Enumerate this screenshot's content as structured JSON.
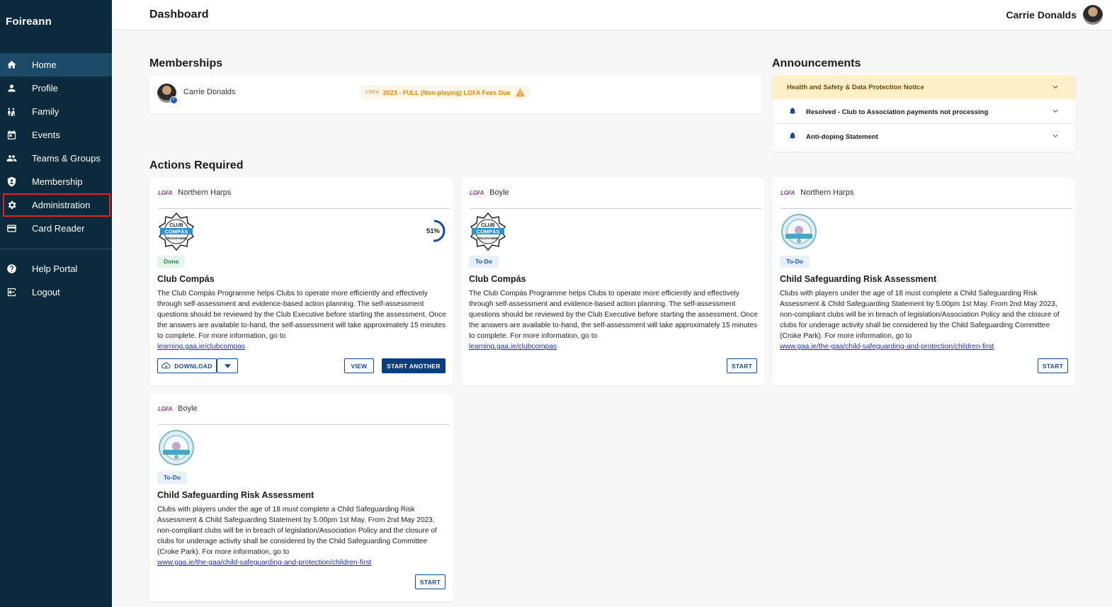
{
  "app": {
    "name": "Foireann"
  },
  "topbar": {
    "title": "Dashboard",
    "user_name": "Carrie Donalds"
  },
  "sidebar": {
    "items": [
      {
        "label": "Home",
        "icon": "home-icon"
      },
      {
        "label": "Profile",
        "icon": "person-icon"
      },
      {
        "label": "Family",
        "icon": "family-icon"
      },
      {
        "label": "Events",
        "icon": "calendar-icon"
      },
      {
        "label": "Teams & Groups",
        "icon": "group-icon"
      },
      {
        "label": "Membership",
        "icon": "shield-icon"
      },
      {
        "label": "Administration",
        "icon": "gear-icon"
      },
      {
        "label": "Card Reader",
        "icon": "card-icon"
      }
    ],
    "footer_items": [
      {
        "label": "Help Portal",
        "icon": "help-icon"
      },
      {
        "label": "Logout",
        "icon": "logout-icon"
      }
    ]
  },
  "memberships": {
    "heading": "Memberships",
    "member_name": "Carrie Donalds",
    "badge_org": "LGFA",
    "badge_text": "2023 - FULL (Non-playing) LGFA Fees Due"
  },
  "announcements": {
    "heading": "Announcements",
    "items": [
      {
        "title": "Health and Safety & Data Protection Notice"
      },
      {
        "title": "Resolved - Club to Association payments not processing"
      },
      {
        "title": "Anti-doping Statement"
      }
    ]
  },
  "actions": {
    "heading": "Actions Required",
    "cards": [
      {
        "org_logo": "LGFA",
        "org": "Northern Harps",
        "status": "Done",
        "title": "Club Compás",
        "desc": "The Club Compás Programme helps Clubs to operate more efficiently and effectively through self-assessment and evidence-based action planning. The self-assessment questions should be reviewed by the Club Executive before starting the assessment. Once the answers are available to-hand, the self-assessment will take approximately 15 minutes to complete. For more information, go to",
        "link": "learning.gaa.ie/clubcompas",
        "progress_label": "51%",
        "progress": 51,
        "download_label": "DOWNLOAD",
        "view_label": "VIEW",
        "start_another_label": "START ANOTHER"
      },
      {
        "org_logo": "LGFA",
        "org": "Boyle",
        "status": "To-Do",
        "title": "Club Compás",
        "desc": "The Club Compás Programme helps Clubs to operate more efficiently and effectively through self-assessment and evidence-based action planning. The self-assessment questions should be reviewed by the Club Executive before starting the assessment. Once the answers are available to-hand, the self-assessment will take approximately 15 minutes to complete. For more information, go to",
        "link": "learning.gaa.ie/clubcompas",
        "start_label": "START"
      },
      {
        "org_logo": "LGFA",
        "org": "Northern Harps",
        "status": "To-Do",
        "title": "Child Safeguarding Risk Assessment",
        "desc": "Clubs with players under the age of 18 must complete a Child Safeguarding Risk Assessment & Child Safeguarding Statement by 5.00pm 1st May. From 2nd May 2023, non-compliant clubs will be in breach of legislation/Association Policy and the closure of clubs for underage activity shall be considered by the Child Safeguarding Committee (Croke Park). For more information, go to",
        "link": "www.gaa.ie/the-gaa/child-safeguarding-and-protection/children-first",
        "start_label": "START"
      },
      {
        "org_logo": "LGFA",
        "org": "Boyle",
        "status": "To-Do",
        "title": "Child Safeguarding Risk Assessment",
        "desc": "Clubs with players under the age of 18 must complete a Child Safeguarding Risk Assessment & Child Safeguarding Statement by 5.00pm 1st May. From 2nd May 2023, non-compliant clubs will be in breach of legislation/Association Policy and the closure of clubs for underage activity shall be considered by the Child Safeguarding Committee (Croke Park). For more information, go to",
        "link": "www.gaa.ie/the-gaa/child-safeguarding-and-protection/children-first",
        "start_label": "START"
      }
    ]
  },
  "logos": {
    "compas_line1": "CLUB",
    "compas_line2": "COMPÁS",
    "compas_line3": "PROGRAMME"
  },
  "colors": {
    "sidebar_bg": "#0b2a3c",
    "accent": "#0d3b82",
    "warning": "#e5850e",
    "highlight_box": "#e02424"
  }
}
